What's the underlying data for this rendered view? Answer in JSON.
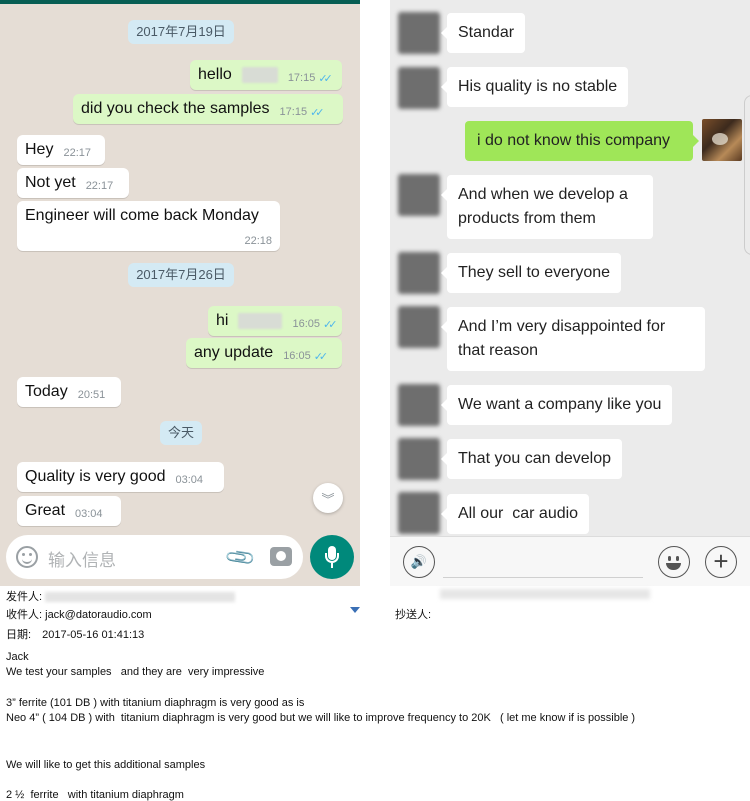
{
  "whatsapp": {
    "dates": [
      "2017年7月19日",
      "2017年7月26日",
      "今天"
    ],
    "messages": [
      {
        "text": "hello",
        "time": "17:15",
        "ticks": "✓✓"
      },
      {
        "text": "did you check the samples",
        "time": "17:15",
        "ticks": "✓✓"
      },
      {
        "text": "Hey",
        "time": "22:17"
      },
      {
        "text": "Not yet",
        "time": "22:17"
      },
      {
        "text": "Engineer will come back Monday",
        "time": "22:18"
      },
      {
        "text": "hi",
        "time": "16:05",
        "ticks": "✓✓"
      },
      {
        "text": "any update",
        "time": "16:05",
        "ticks": "✓✓"
      },
      {
        "text": "Today",
        "time": "20:51"
      },
      {
        "text": "Quality is very good",
        "time": "03:04"
      },
      {
        "text": "Great",
        "time": "03:04"
      }
    ],
    "scroll_icon": "chevron-double-down",
    "input_placeholder": "输入信息"
  },
  "wechat": {
    "incoming": [
      "Standar",
      "His quality is no stable",
      "And when we develop a products from them",
      "They sell to everyone",
      "And I’m very disappointed for that reason",
      "We want a company like you",
      "That you can develop",
      "All our  car audio"
    ],
    "outgoing": "i do not know this company",
    "voice_icon": "🔊",
    "plus_icon": "+"
  },
  "email": {
    "from_label": "发件人:",
    "to_label": "收件人:",
    "to_value": "jack@datoraudio.com",
    "date_label": "日期:",
    "date_value": "2017-05-16 01:41:13",
    "cc_label": "抄送人:",
    "body": [
      "Jack",
      "We test your samples   and they are  very impressive",
      "3” ferrite (101 DB ) with titanium diaphragm is very good  as is",
      "Neo 4” ( 104 DB ) with  titanium diaphragm is very good but we will like to improve frequency to 20K   ( let me know if is possible )",
      "We will like to get this additional samples",
      "2 ½  ferrite   with titanium diaphragm"
    ]
  }
}
